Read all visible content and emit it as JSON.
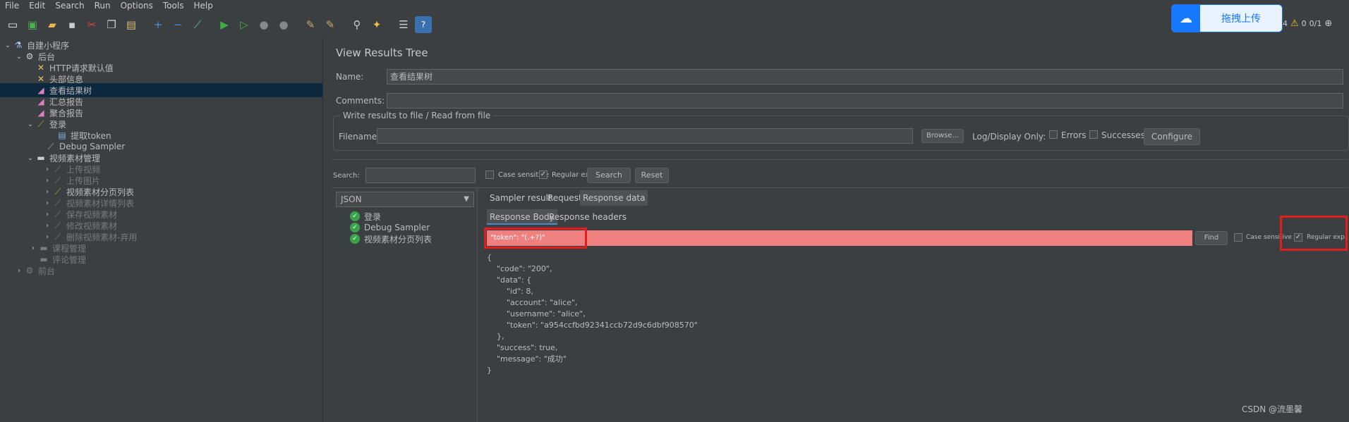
{
  "menu": [
    "File",
    "Edit",
    "Search",
    "Run",
    "Options",
    "Tools",
    "Help"
  ],
  "toolbar_icons": [
    "new-icon",
    "templates-icon",
    "open-icon",
    "save-icon",
    "cut-icon",
    "copy-icon",
    "paste-icon",
    "expand-icon",
    "collapse-icon",
    "toggle-icon",
    "start-icon",
    "start-no-pause-icon",
    "stop-icon",
    "shutdown-icon",
    "clear-icon",
    "clear-all-icon",
    "search-icon",
    "reset-search-icon",
    "function-helper-icon",
    "help-icon"
  ],
  "cloud_upload": {
    "label": "拖拽上传"
  },
  "status": {
    "left": "4",
    "warnings": "0",
    "threads": "0/1"
  },
  "tree": [
    {
      "label": "自建小程序",
      "dim": false
    },
    {
      "label": "后台",
      "dim": false
    },
    {
      "label": "HTTP请求默认值",
      "dim": false
    },
    {
      "label": "头部信息",
      "dim": false
    },
    {
      "label": "查看结果树",
      "dim": false
    },
    {
      "label": "汇总报告",
      "dim": false
    },
    {
      "label": "聚合报告",
      "dim": false
    },
    {
      "label": "登录",
      "dim": false
    },
    {
      "label": "提取token",
      "dim": false
    },
    {
      "label": "Debug Sampler",
      "dim": false
    },
    {
      "label": "视频素材管理",
      "dim": false
    },
    {
      "label": "上传视频",
      "dim": true
    },
    {
      "label": "上传图片",
      "dim": true
    },
    {
      "label": "视频素材分页列表",
      "dim": false
    },
    {
      "label": "视频素材详情列表",
      "dim": true
    },
    {
      "label": "保存视频素材",
      "dim": true
    },
    {
      "label": "修改视频素材",
      "dim": true
    },
    {
      "label": "删除视频素材-弃用",
      "dim": true
    },
    {
      "label": "课程管理",
      "dim": true
    },
    {
      "label": "评论管理",
      "dim": true
    },
    {
      "label": "前台",
      "dim": true
    }
  ],
  "panel": {
    "title": "View Results Tree",
    "name_label": "Name:",
    "name_value": "查看结果树",
    "comments_label": "Comments:",
    "write_group": "Write results to file / Read from file",
    "filename_label": "Filename",
    "browse": "Browse...",
    "log_display": "Log/Display Only:",
    "errors": "Errors",
    "successes": "Successes",
    "configure": "Configure",
    "search_label": "Search:",
    "case_sensitive": "Case sensitive",
    "regular_exp": "Regular exp.",
    "search_btn": "Search",
    "reset_btn": "Reset"
  },
  "results": {
    "renderer": "JSON",
    "items": [
      "登录",
      "Debug Sampler",
      "视频素材分页列表"
    ],
    "tabs": [
      "Sampler result",
      "Request",
      "Response data"
    ],
    "subtabs": [
      "Response Body",
      "Response headers"
    ],
    "find_value": "\"token\": \"(.+?)\"",
    "find_btn": "Find",
    "case_sensitive": "Case sensitive",
    "regular_exp": "Regular exp."
  },
  "json_lines": [
    "{",
    "    \"code\": \"200\",",
    "    \"data\": {",
    "        \"id\": 8,",
    "        \"account\": \"alice\",",
    "        \"username\": \"alice\",",
    "        \"token\": \"a954ccfbd92341ccb72d9c6dbf908570\"",
    "    },",
    "    \"success\": true,",
    "    \"message\": \"成功\"",
    "}"
  ],
  "watermark": "CSDN @流墨馨"
}
